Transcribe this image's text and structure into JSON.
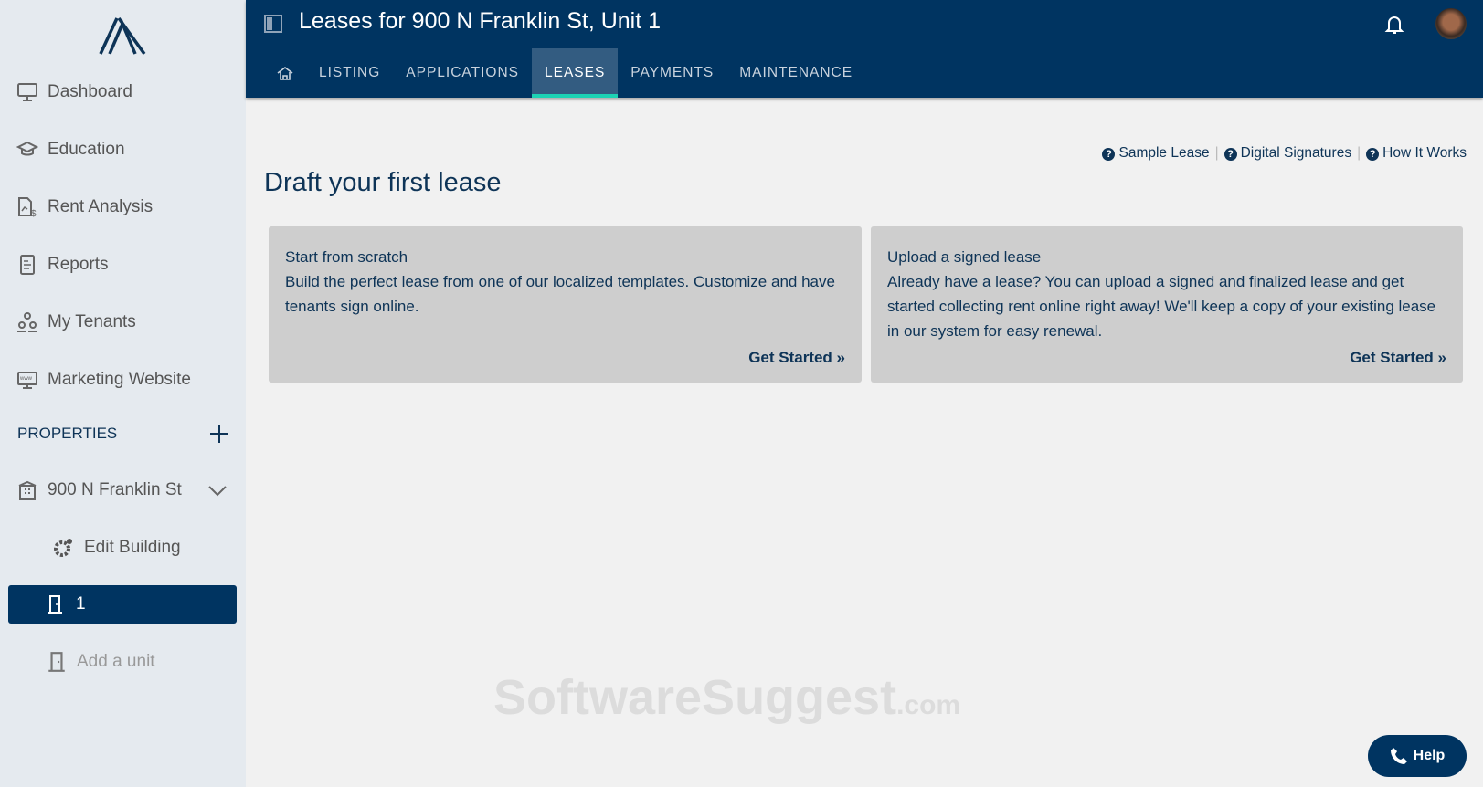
{
  "sidebar": {
    "items": [
      {
        "label": "Dashboard"
      },
      {
        "label": "Education"
      },
      {
        "label": "Rent Analysis"
      },
      {
        "label": "Reports"
      },
      {
        "label": "My Tenants"
      },
      {
        "label": "Marketing Website"
      }
    ],
    "properties_label": "PROPERTIES",
    "property": "900 N Franklin St",
    "edit_building": "Edit Building",
    "active_unit": "1",
    "add_unit": "Add a unit"
  },
  "header": {
    "title": "Leases for 900 N Franklin St, Unit 1",
    "tabs": [
      {
        "label": "LISTING"
      },
      {
        "label": "APPLICATIONS"
      },
      {
        "label": "LEASES"
      },
      {
        "label": "PAYMENTS"
      },
      {
        "label": "MAINTENANCE"
      }
    ]
  },
  "main": {
    "links": [
      "Sample Lease",
      "Digital Signatures",
      "How It Works"
    ],
    "heading": "Draft your first lease",
    "cards": [
      {
        "title": "Start from scratch",
        "body": "Build the perfect lease from one of our localized templates. Customize and have tenants sign online.",
        "action": "Get Started »"
      },
      {
        "title": "Upload a signed lease",
        "body": "Already have a lease? You can upload a signed and finalized lease and get started collecting rent online right away! We'll keep a copy of your existing lease in our system for easy renewal.",
        "action": "Get Started »"
      }
    ]
  },
  "watermark": {
    "main": "SoftwareSuggest",
    "suffix": ".com"
  },
  "help_label": "Help",
  "colors": {
    "navy": "#003461",
    "accent": "#1dd2b4"
  }
}
